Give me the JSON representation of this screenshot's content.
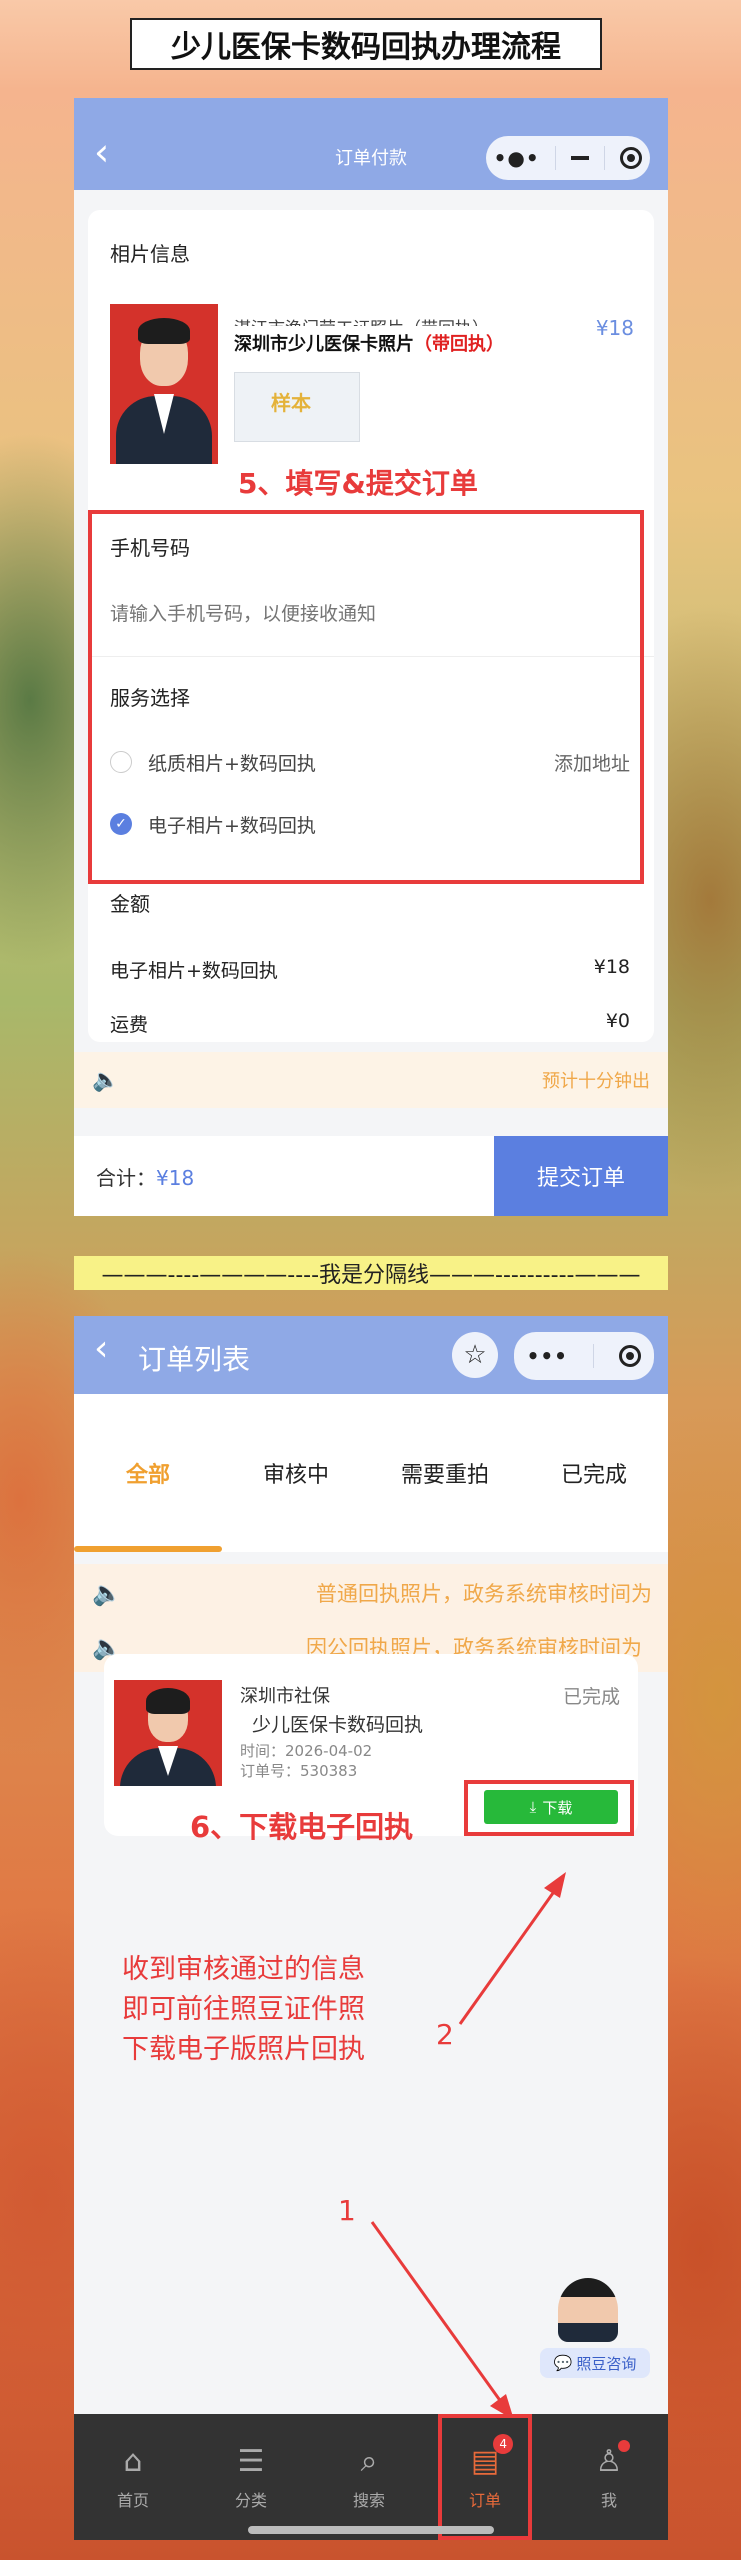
{
  "header": {
    "title": "少儿医保卡数码回执办理流程"
  },
  "screen1": {
    "nav_title": "订单付款",
    "photo_section": {
      "label": "相片信息",
      "item_title_cut": "湛江市渔门劳工证照片（带回执）",
      "item_title": "深圳市少儿医保卡照片",
      "item_tag": "（带回执）",
      "price": "¥18",
      "sample_word": "样本"
    },
    "step5_annotation": "5、填写&提交订单",
    "phone": {
      "label": "手机号码",
      "placeholder": "请输入手机号码，以便接收通知"
    },
    "service": {
      "label": "服务选择",
      "options": [
        {
          "label": "纸质相片+数码回执",
          "extra": "添加地址",
          "checked": false
        },
        {
          "label": "电子相片+数码回执",
          "extra": "",
          "checked": true
        }
      ]
    },
    "amount": {
      "label": "金额",
      "rows": [
        {
          "name": "电子相片+数码回执",
          "value": "¥18"
        },
        {
          "name": "运费",
          "value": "¥0"
        }
      ]
    },
    "notice": "预计十分钟出",
    "total_label": "合计：",
    "total_value": "¥18",
    "submit_label": "提交订单"
  },
  "divider": {
    "text": "———----————----我是分隔线———----------———"
  },
  "screen2": {
    "nav_title": "订单列表",
    "tabs": [
      "全部",
      "审核中",
      "需要重拍",
      "已完成"
    ],
    "notices": [
      "普通回执照片，政务系统审核时间为",
      "因公回执照片，政务系统审核时间为"
    ],
    "order": {
      "org": "深圳市社保",
      "title": "少儿医保卡数码回执",
      "status": "已完成",
      "time": "时间：2026-04-02",
      "order_no": "订单号：530383",
      "download_label": "下载"
    },
    "step6_annotation": "6、下载电子回执",
    "instruction_lines": [
      "收到审核通过的信息",
      "即可前往照豆证件照",
      "下载电子版照片回执"
    ],
    "marker_1": "1",
    "marker_2": "2",
    "consult_label": "照豆咨询",
    "tabbar": [
      {
        "label": "首页",
        "icon": "home-icon"
      },
      {
        "label": "分类",
        "icon": "category-icon"
      },
      {
        "label": "搜索",
        "icon": "search-icon"
      },
      {
        "label": "订单",
        "icon": "order-icon",
        "badge": "4"
      },
      {
        "label": "我",
        "icon": "profile-icon"
      }
    ]
  },
  "colors": {
    "accent": "#5b7fe0",
    "annotation_red": "#e83b3b",
    "orange": "#f0a030",
    "green": "#27b93a"
  }
}
